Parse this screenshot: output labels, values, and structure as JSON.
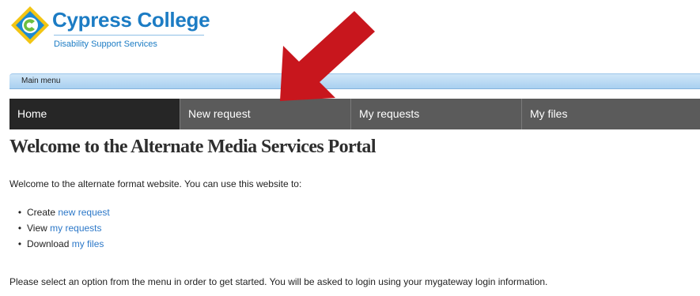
{
  "header": {
    "logo_title": "Cypress College",
    "logo_subtitle": "Disability Support Services"
  },
  "menubar": {
    "label": "Main menu"
  },
  "nav": {
    "items": [
      {
        "label": "Home",
        "active": true
      },
      {
        "label": "New request",
        "active": false
      },
      {
        "label": "My requests",
        "active": false
      },
      {
        "label": "My files",
        "active": false
      }
    ]
  },
  "main": {
    "title": "Welcome to the Alternate Media Services Portal",
    "intro": "Welcome to the alternate format website. You can use this website to:",
    "options": [
      {
        "verb": "Create",
        "link": "new request"
      },
      {
        "verb": "View",
        "link": "my requests"
      },
      {
        "verb": "Download",
        "link": "my files"
      }
    ],
    "footer": "Please select an option from the menu in order to get started. You will be asked to login using your mygateway login information."
  },
  "colors": {
    "accent": "#1c7cc4",
    "nav_bg": "#5b5b5b",
    "nav_active_bg": "#262626",
    "link": "#2c78c8",
    "arrow": "#c8161d"
  },
  "icons": {
    "logo": "cypress-college-logo-icon",
    "annotation": "red-arrow-icon"
  }
}
